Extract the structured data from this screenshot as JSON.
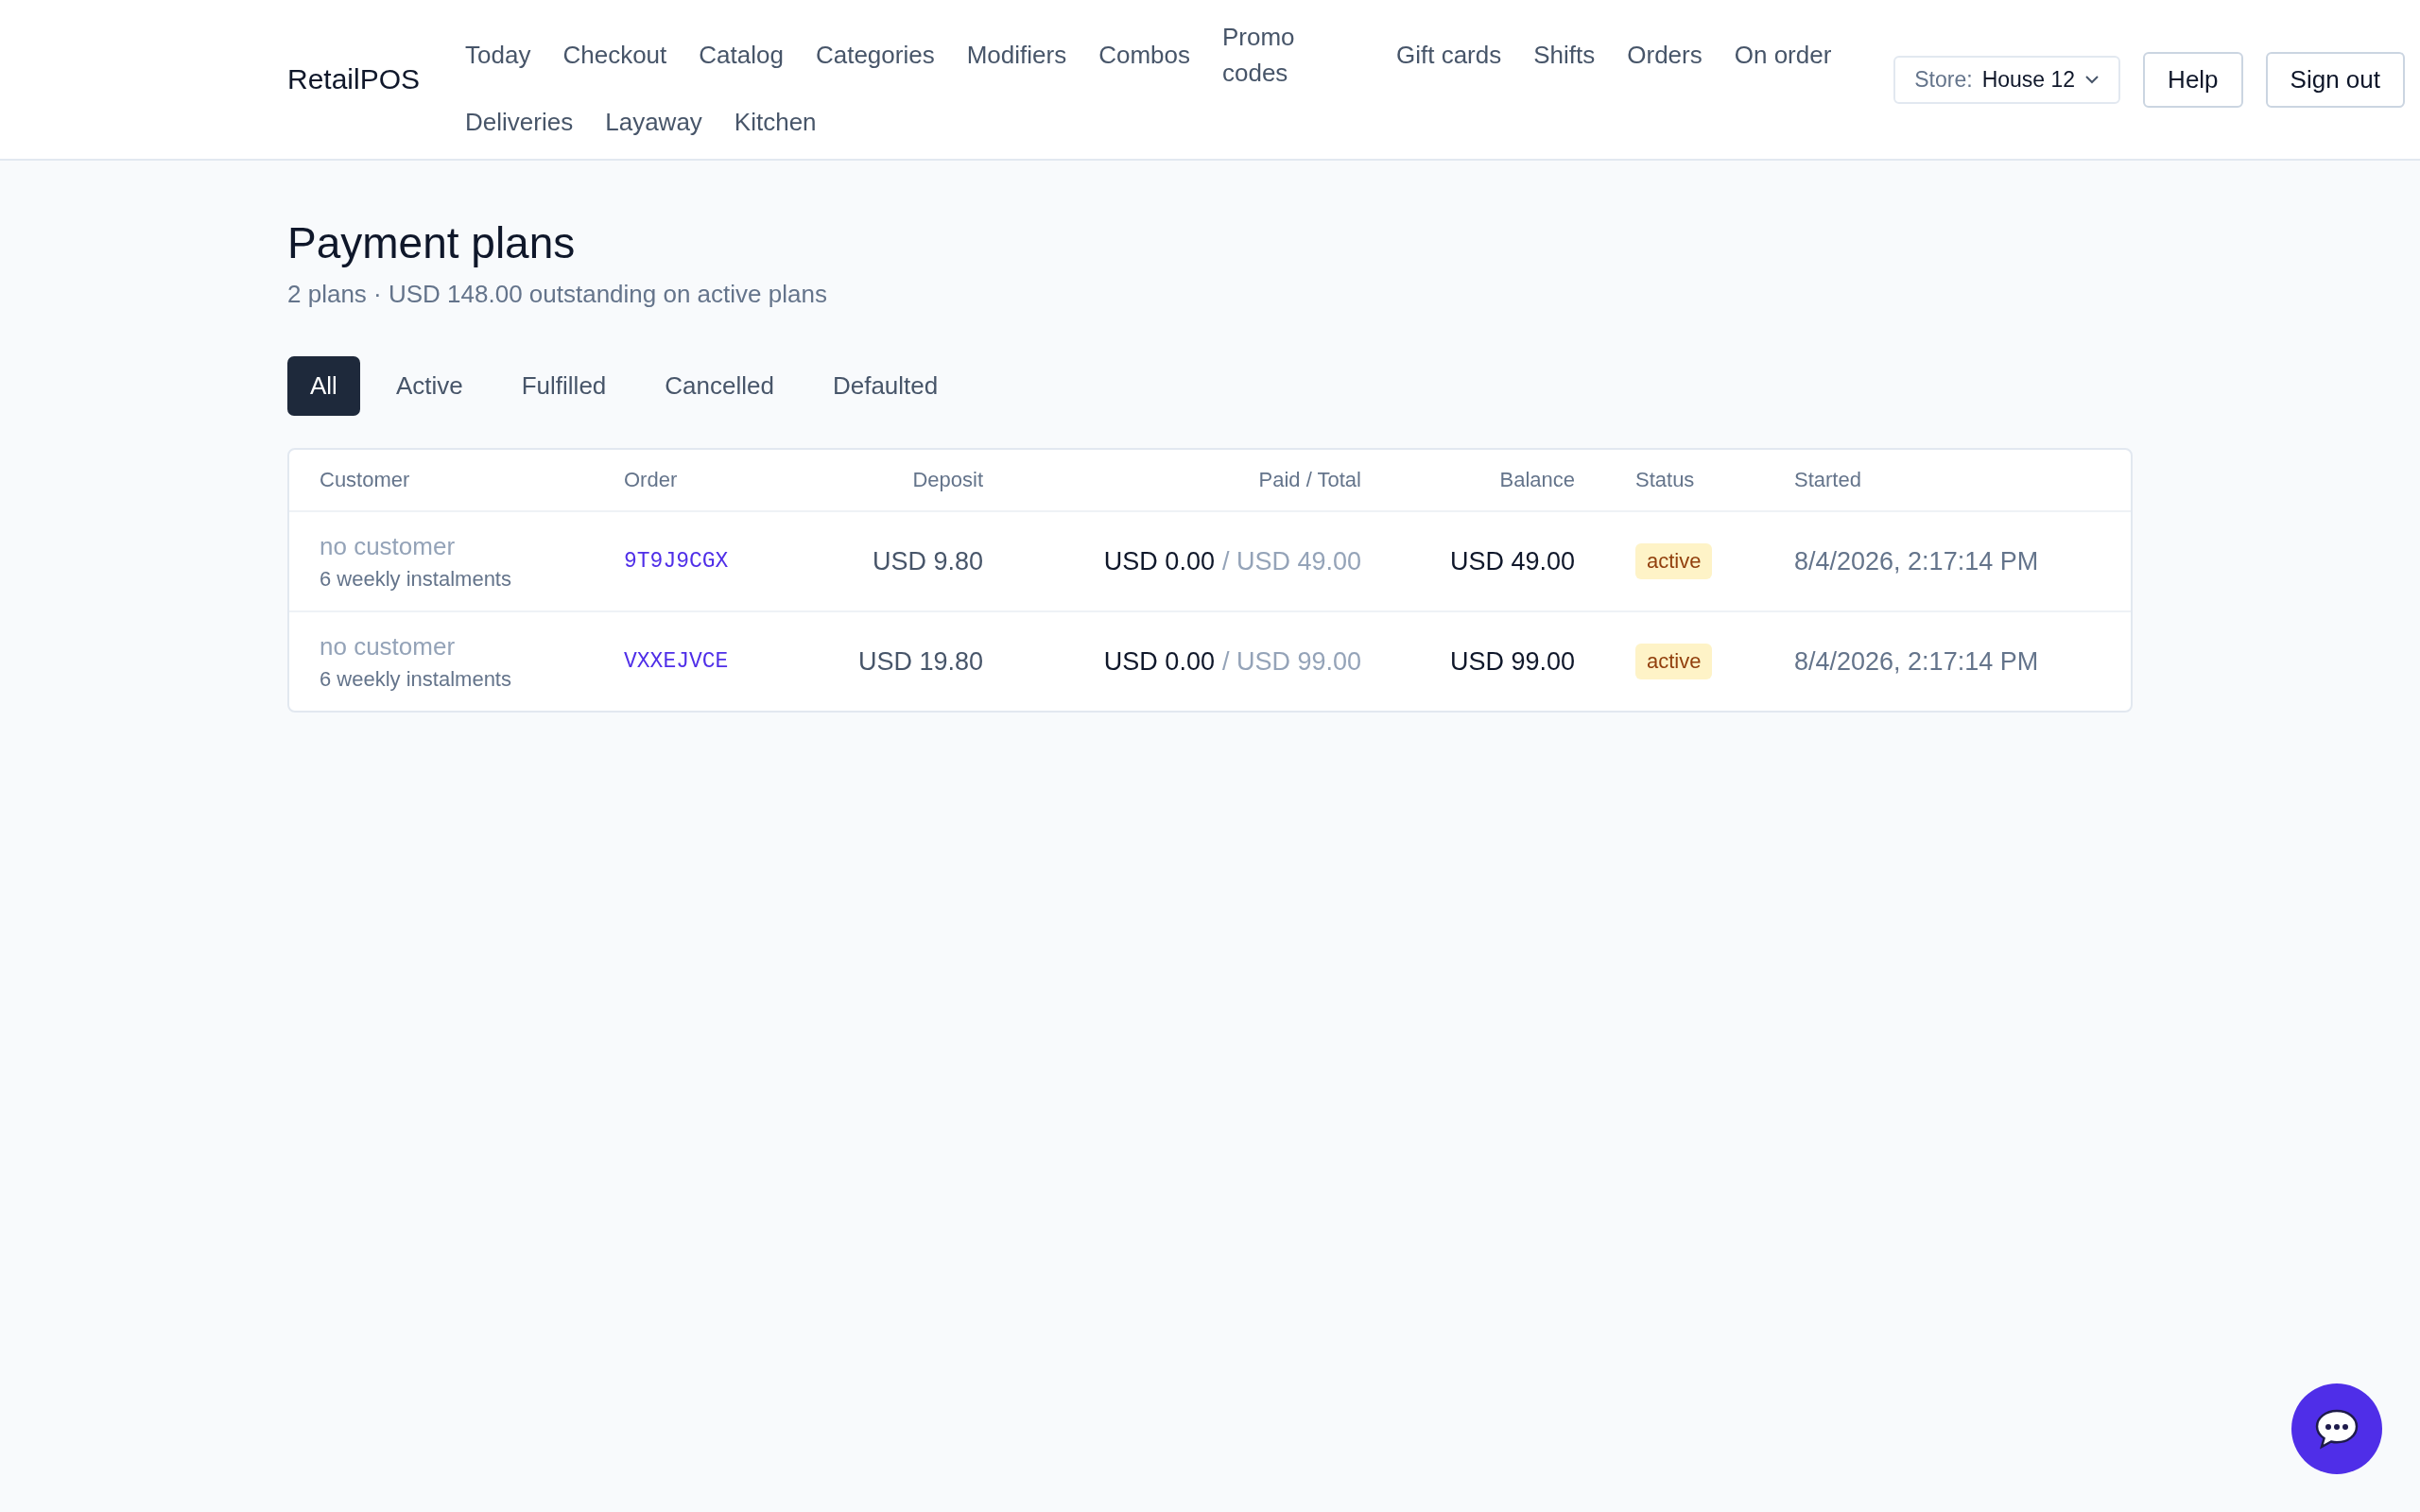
{
  "brand": "RetailPOS",
  "nav": [
    {
      "label": "Today"
    },
    {
      "label": "Checkout"
    },
    {
      "label": "Catalog"
    },
    {
      "label": "Categories"
    },
    {
      "label": "Modifiers"
    },
    {
      "label": "Combos"
    },
    {
      "label": "Promo codes"
    },
    {
      "label": "Gift cards"
    },
    {
      "label": "Shifts"
    },
    {
      "label": "Orders"
    },
    {
      "label": "On order"
    },
    {
      "label": "Deliveries"
    },
    {
      "label": "Layaway"
    },
    {
      "label": "Kitchen"
    }
  ],
  "store_select": {
    "label": "Store:",
    "value": "House 12"
  },
  "header_buttons": [
    "Help",
    "Sign out"
  ],
  "page": {
    "title": "Payment plans",
    "subtitle": "2 plans · USD 148.00 outstanding on active plans"
  },
  "filters": [
    {
      "label": "All",
      "selected": true
    },
    {
      "label": "Active",
      "selected": false
    },
    {
      "label": "Fulfilled",
      "selected": false
    },
    {
      "label": "Cancelled",
      "selected": false
    },
    {
      "label": "Defaulted",
      "selected": false
    }
  ],
  "table": {
    "columns": [
      "Customer",
      "Order",
      "Deposit",
      "Paid / Total",
      "Balance",
      "Status",
      "Started"
    ],
    "rows": [
      {
        "customer": "no customer",
        "schedule": "6 weekly instalments",
        "order": "9T9J9CGX",
        "deposit": "USD 9.80",
        "paid": "USD 0.00",
        "total": "/ USD 49.00",
        "balance": "USD 49.00",
        "status": "active",
        "started": "8/4/2026, 2:17:14 PM"
      },
      {
        "customer": "no customer",
        "schedule": "6 weekly instalments",
        "order": "VXXEJVCE",
        "deposit": "USD 19.80",
        "paid": "USD 0.00",
        "total": "/ USD 99.00",
        "balance": "USD 99.00",
        "status": "active",
        "started": "8/4/2026, 2:17:14 PM"
      }
    ]
  }
}
